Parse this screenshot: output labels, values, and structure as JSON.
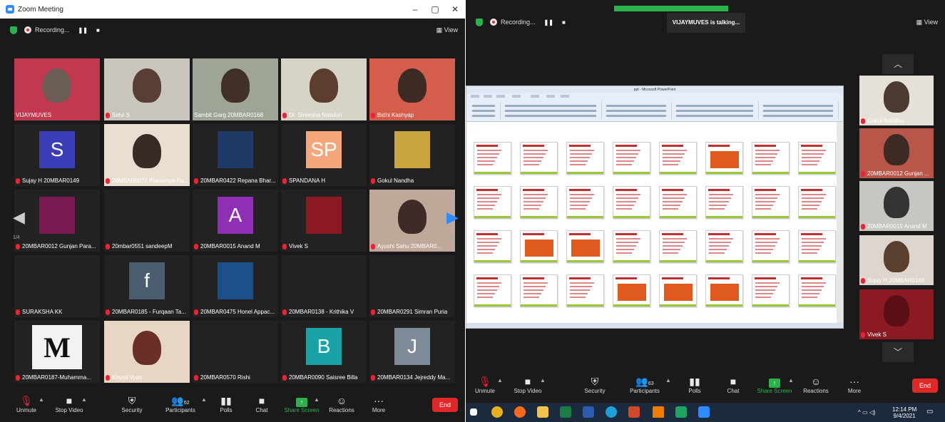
{
  "left_window": {
    "title": "Zoom Meeting",
    "controls": [
      "–",
      "▢",
      "✕"
    ],
    "recording_label": "Recording...",
    "view_label": "View",
    "page_left": "1/4",
    "page_right": "1/4",
    "participants_grid": [
      {
        "name": "VIJAYMUVES",
        "muted": false,
        "kind": "video",
        "bg": "#c2384e",
        "fg": "#6b5d55",
        "active": true
      },
      {
        "name": "Selvi S",
        "muted": true,
        "kind": "video",
        "bg": "#c9c5bd",
        "fg": "#5a3e35"
      },
      {
        "name": "Sambit Garg 20MBAR0168",
        "muted": false,
        "kind": "video",
        "bg": "#9ea597",
        "fg": "#403028"
      },
      {
        "name": "Dr. Sireesha Nanduri",
        "muted": true,
        "kind": "video",
        "bg": "#d8d3c7",
        "fg": "#5b3e2e"
      },
      {
        "name": "Bidhi Kashyap",
        "muted": true,
        "kind": "video",
        "bg": "#d45d4c",
        "fg": "#3c2a24"
      },
      {
        "name": "Sujay H 20MBAR0149",
        "muted": true,
        "kind": "avatar",
        "bg": "#3a3fb8",
        "text": "S"
      },
      {
        "name": "20MBAR0077 Pranamya Pa...",
        "muted": true,
        "kind": "video",
        "bg": "#e8dfd1",
        "fg": "#3a2a26"
      },
      {
        "name": "20MBAR0422 Repana Bhar...",
        "muted": true,
        "kind": "avatar",
        "bg": "#1f3a66",
        "text": ""
      },
      {
        "name": "SPANDANA H",
        "muted": true,
        "kind": "avatar",
        "bg": "#f4a77a",
        "text": "SP"
      },
      {
        "name": "Gokul Nandha",
        "muted": true,
        "kind": "avatar",
        "bg": "#caa43c",
        "text": ""
      },
      {
        "name": "20MBAR0012 Gunjan Para...",
        "muted": true,
        "kind": "avatar",
        "bg": "#7a1a52",
        "text": ""
      },
      {
        "name": "20mbar0551 sandeepM",
        "muted": true,
        "kind": "blank",
        "bg": "#111111",
        "text": ""
      },
      {
        "name": "20MBAR0015 Anand M",
        "muted": true,
        "kind": "avatar",
        "bg": "#8e2fb5",
        "text": "A"
      },
      {
        "name": "Vivek S",
        "muted": true,
        "kind": "avatar",
        "bg": "#8b1a22",
        "text": ""
      },
      {
        "name": "Ayushi Sahu 20MBAR0...",
        "muted": true,
        "kind": "video",
        "bg": "#bfa79a",
        "fg": "#3e2a26"
      },
      {
        "name": "SURAKSHA KK",
        "muted": true,
        "kind": "blank",
        "bg": "#111111",
        "text": ""
      },
      {
        "name": "20MBAR0185 - Furqaan Ta...",
        "muted": true,
        "kind": "avatar",
        "bg": "#4a5d6e",
        "text": "f"
      },
      {
        "name": "20MBAR0475 Honel Appac...",
        "muted": true,
        "kind": "avatar",
        "bg": "#1d4f8a",
        "text": ""
      },
      {
        "name": "20MBAR0138 - Krithika V",
        "muted": true,
        "kind": "blank",
        "bg": "#111111",
        "text": ""
      },
      {
        "name": "20MBAR0291 Simran Puria",
        "muted": true,
        "kind": "blank",
        "bg": "#111111",
        "text": ""
      },
      {
        "name": "20MBAR0187-Muhamma...",
        "muted": true,
        "kind": "avatar",
        "bg": "#f2f2f2",
        "text": "M",
        "dark": true
      },
      {
        "name": "Khyati Vyas",
        "muted": true,
        "kind": "video",
        "bg": "#e8d6c4",
        "fg": "#6a3028"
      },
      {
        "name": "20MBAR0570 Rishi",
        "muted": true,
        "kind": "blank",
        "bg": "#111111",
        "text": ""
      },
      {
        "name": "20MBAR0090 Saisree Billa",
        "muted": true,
        "kind": "avatar",
        "bg": "#1aa3a6",
        "text": "B"
      },
      {
        "name": "20MBAR0134 Jejreddy Ma...",
        "muted": true,
        "kind": "avatar",
        "bg": "#7d8c98",
        "text": "J"
      }
    ],
    "toolbar": {
      "unmute": "Unmute",
      "stop_video": "Stop Video",
      "security": "Security",
      "participants": "Participants",
      "participants_count": "62",
      "polls": "Polls",
      "chat": "Chat",
      "share_screen": "Share Screen",
      "reactions": "Reactions",
      "more": "More",
      "end": "End"
    }
  },
  "right_window": {
    "recording_label": "Recording...",
    "view_label": "View",
    "talking_label": "VIJAYMUVES is talking...",
    "ppt_title": "ppt - Microsoft PowerPoint",
    "side_participants": [
      {
        "name": "Gokul Nandha",
        "bg": "#e6e1d8",
        "fg": "#4b3b30"
      },
      {
        "name": "20MBAR0012 Gunjan ...",
        "bg": "#b8564a",
        "fg": "#3c2a24"
      },
      {
        "name": "20MBAR0015 Anand M",
        "bg": "#c8c6c0",
        "fg": "#333333"
      },
      {
        "name": "Sujay H 20MBAR0149",
        "bg": "#ddd6cf",
        "fg": "#5a3e2e"
      },
      {
        "name": "Vivek S",
        "bg": "#8b1a22",
        "fg": "#5a0f14"
      }
    ],
    "toolbar": {
      "unmute": "Unmute",
      "stop_video": "Stop Video",
      "security": "Security",
      "participants": "Participants",
      "participants_count": "63",
      "polls": "Polls",
      "chat": "Chat",
      "share_screen": "Share Screen",
      "reactions": "Reactions",
      "more": "More",
      "end": "End"
    },
    "taskbar": {
      "time": "12:14 PM",
      "date": "9/4/2021"
    }
  }
}
